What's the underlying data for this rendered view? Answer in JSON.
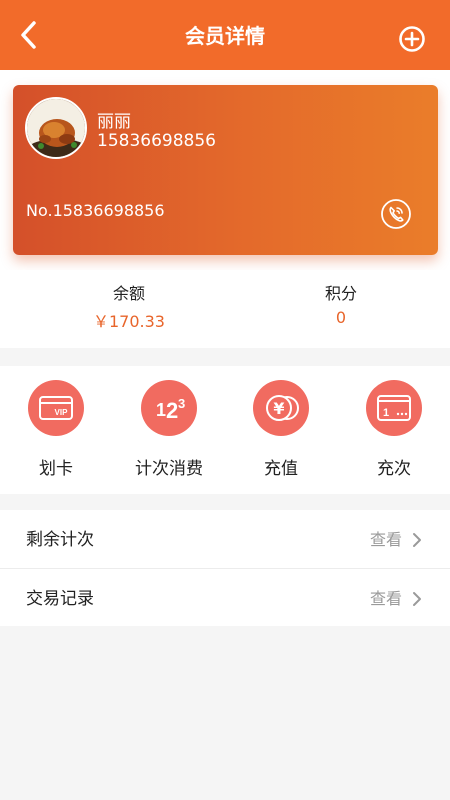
{
  "header": {
    "title": "会员详情",
    "back_icon": "chevron-left-icon",
    "add_icon": "plus-circle-icon",
    "bg_color": "#f26b2a"
  },
  "member": {
    "name": "丽丽",
    "phone": "15836698856",
    "card_no": "No.15836698856",
    "call_icon": "phone-icon"
  },
  "stats": {
    "balance_label": "余额",
    "balance_value": "￥170.33",
    "points_label": "积分",
    "points_value": "0",
    "value_color": "#e8652b"
  },
  "actions": [
    {
      "label": "划卡",
      "icon": "vip-card-icon"
    },
    {
      "label": "计次消费",
      "icon": "count-123-icon"
    },
    {
      "label": "充值",
      "icon": "yen-coin-icon"
    },
    {
      "label": "充次",
      "icon": "count-card-icon"
    }
  ],
  "list": [
    {
      "label": "剩余计次",
      "action": "查看"
    },
    {
      "label": "交易记录",
      "action": "查看"
    }
  ]
}
